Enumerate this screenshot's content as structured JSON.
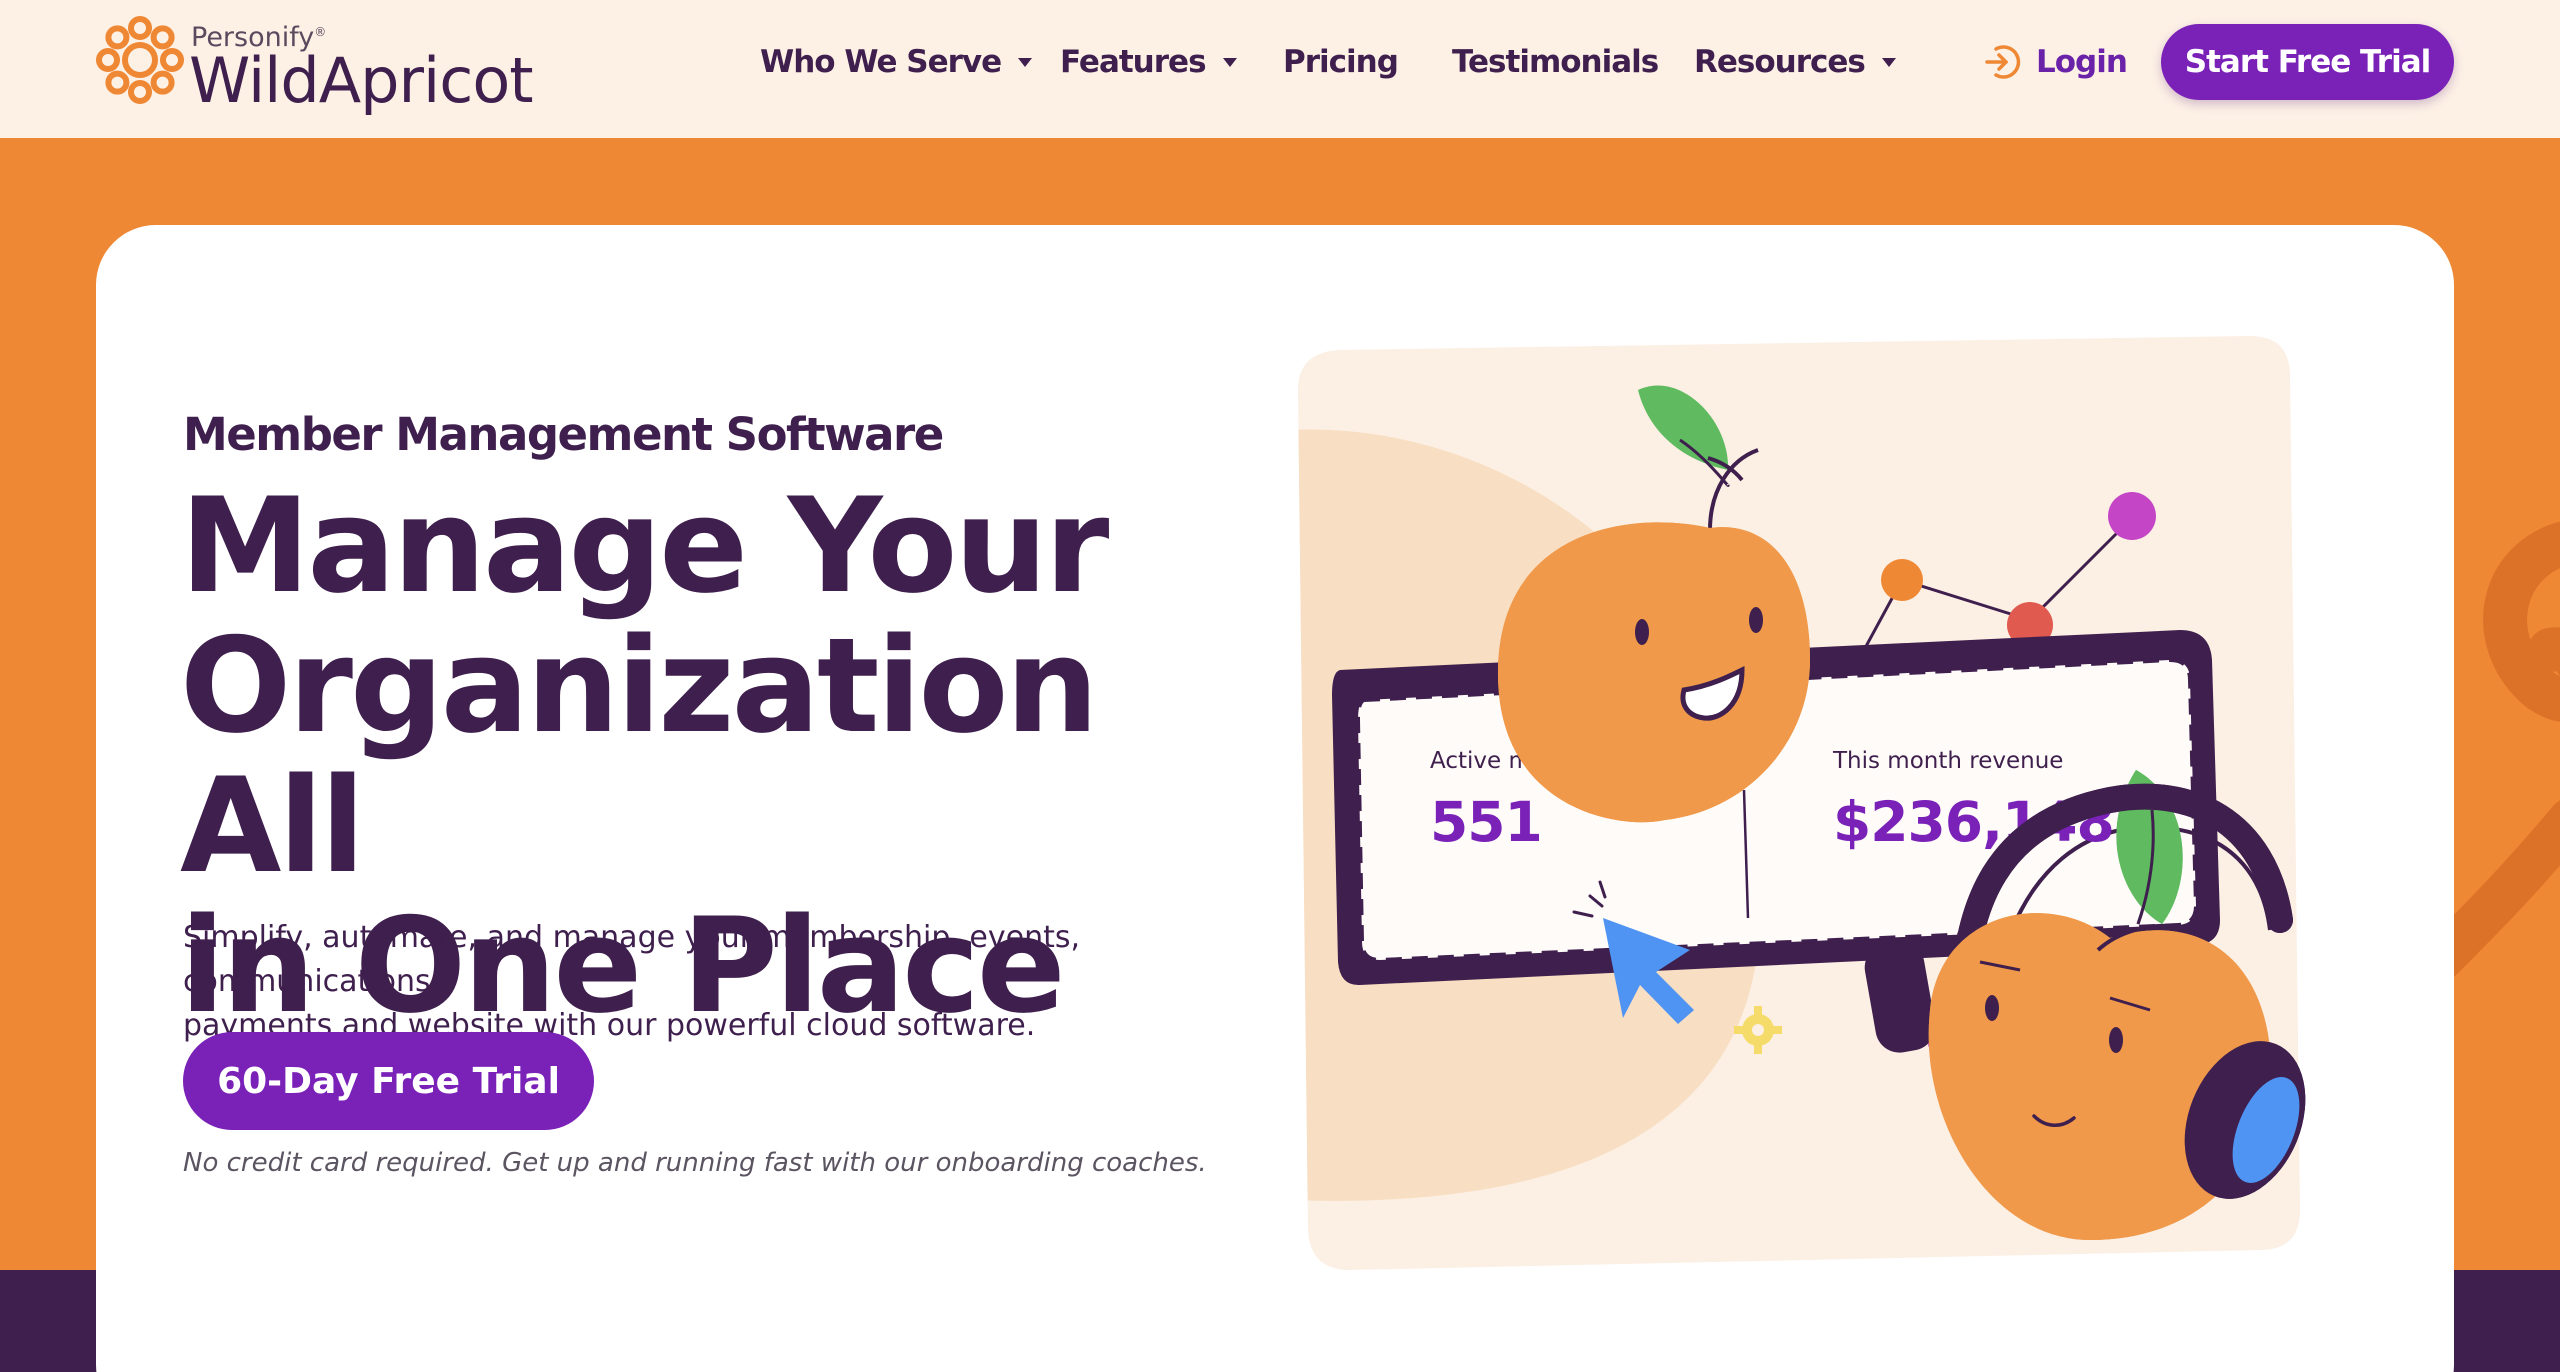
{
  "brand": {
    "parent": "Personify",
    "name": "WildApricot",
    "colors": {
      "orange": "#ef8834",
      "purple": "#7a21b8",
      "dark": "#3e1f4d",
      "cream": "#fdf1e6"
    }
  },
  "nav": {
    "items": [
      {
        "label": "Who We Serve",
        "has_dropdown": true
      },
      {
        "label": "Features",
        "has_dropdown": true
      },
      {
        "label": "Pricing",
        "has_dropdown": false
      },
      {
        "label": "Testimonials",
        "has_dropdown": false
      },
      {
        "label": "Resources",
        "has_dropdown": true
      }
    ],
    "login_label": "Login",
    "cta_label": "Start Free Trial"
  },
  "hero": {
    "eyebrow": "Member Management Software",
    "headline_lines": [
      "Manage Your",
      "Organization All",
      "in One Place"
    ],
    "description_lines": [
      "Simplify, automate, and manage your membership, events, communications,",
      "payments and website with our powerful cloud software."
    ],
    "cta_label": "60-Day Free Trial",
    "note": "No credit card required. Get up and running fast with our onboarding coaches."
  },
  "illustration": {
    "stats": [
      {
        "label": "Active members",
        "value": "551"
      },
      {
        "label": "This month revenue",
        "value": "$236,148"
      }
    ]
  }
}
